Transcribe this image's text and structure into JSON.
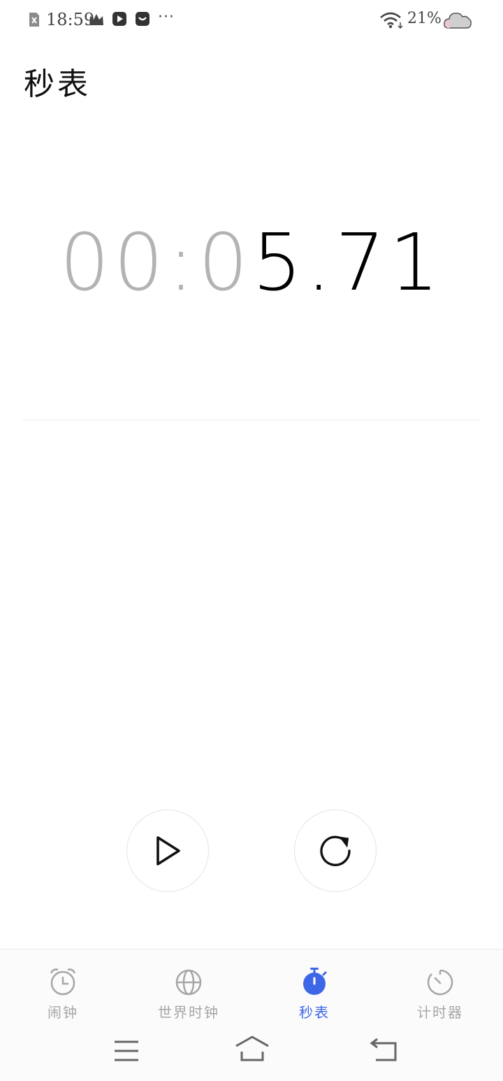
{
  "status_bar": {
    "time": "18:59",
    "battery_percent": "21%",
    "more_indicator": "···"
  },
  "page_title": "秒表",
  "stopwatch": {
    "dim_part": "00:0",
    "bright_part": "5.71"
  },
  "controls": {
    "start_icon": "play-icon",
    "reset_icon": "reset-icon"
  },
  "tabs": [
    {
      "label": "闹钟",
      "icon": "alarm-clock-icon",
      "active": false
    },
    {
      "label": "世界时钟",
      "icon": "globe-icon",
      "active": false
    },
    {
      "label": "秒表",
      "icon": "stopwatch-icon",
      "active": true
    },
    {
      "label": "计时器",
      "icon": "timer-icon",
      "active": false
    }
  ],
  "colors": {
    "accent": "#3e67e8",
    "inactive_tab": "#a6a6a6",
    "dim_digits": "#b3b3b3"
  },
  "system_nav": {
    "menu_icon": "menu-icon",
    "home_icon": "home-icon",
    "back_icon": "back-icon"
  }
}
